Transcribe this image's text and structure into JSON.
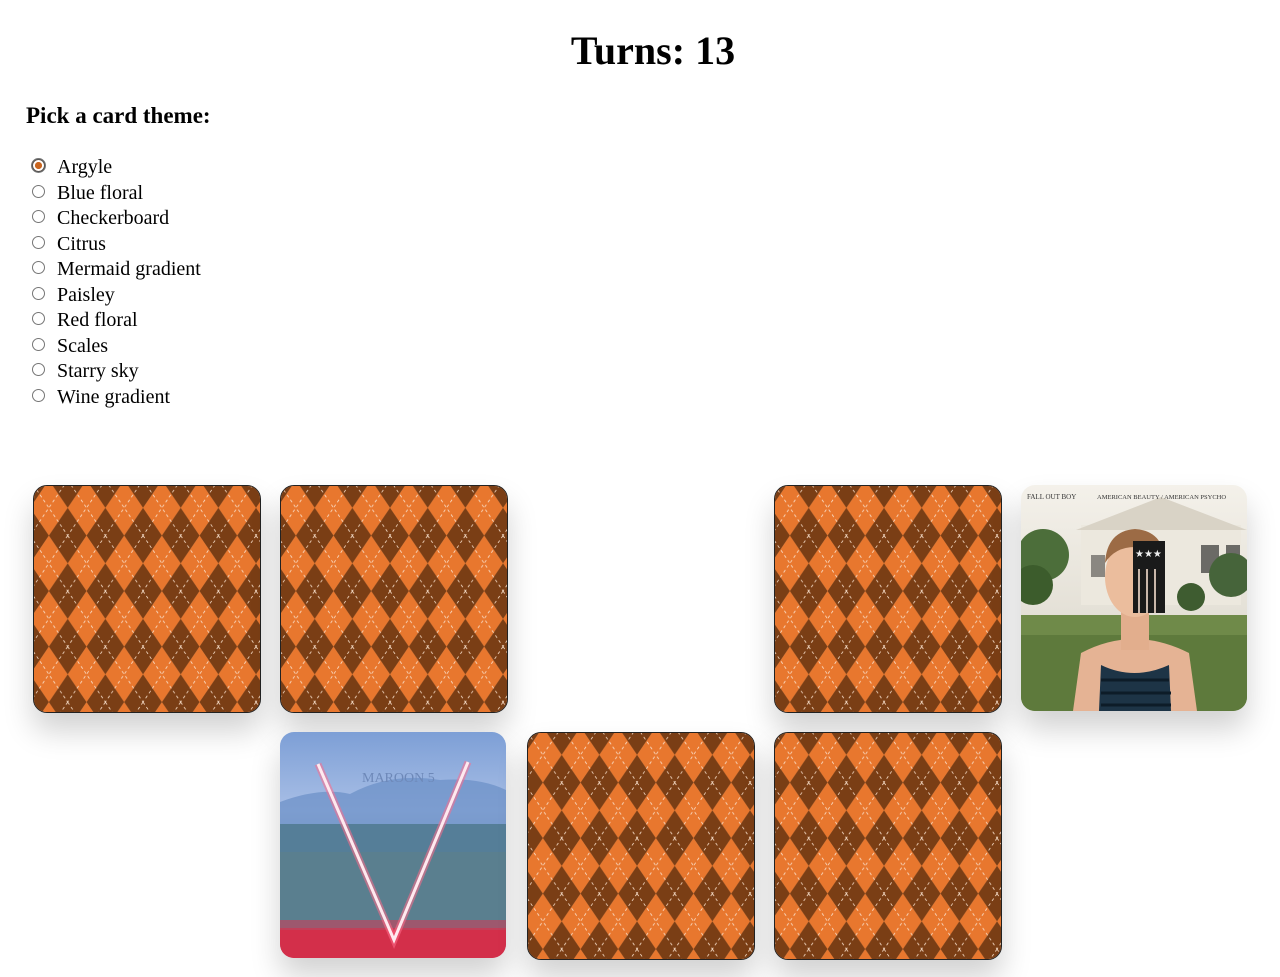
{
  "game": {
    "turns_label": "Turns: 13"
  },
  "theme_picker": {
    "heading": "Pick a card theme:",
    "selected": "Argyle",
    "options": [
      "Argyle",
      "Blue floral",
      "Checkerboard",
      "Citrus",
      "Mermaid gradient",
      "Paisley",
      "Red floral",
      "Scales",
      "Starry sky",
      "Wine gradient"
    ]
  },
  "colors": {
    "argyle_light": "#f2a06a",
    "argyle_mid": "#e8772e",
    "argyle_dark": "#7a3e15"
  },
  "cards": [
    {
      "row": 1,
      "col": 1,
      "state": "face-down",
      "theme": "Argyle"
    },
    {
      "row": 1,
      "col": 2,
      "state": "face-down",
      "theme": "Argyle"
    },
    {
      "row": 1,
      "col": 3,
      "state": "removed"
    },
    {
      "row": 1,
      "col": 4,
      "state": "face-down",
      "theme": "Argyle"
    },
    {
      "row": 1,
      "col": 5,
      "state": "face-up",
      "face": "fall-out-boy-cover",
      "cover_text_left": "FALL OUT BOY",
      "cover_text_right": "AMERICAN BEAUTY / AMERICAN PSYCHO"
    },
    {
      "row": 2,
      "col": 1,
      "state": "removed"
    },
    {
      "row": 2,
      "col": 2,
      "state": "face-up",
      "face": "maroon5-v-cover",
      "cover_text": "MAROON 5"
    },
    {
      "row": 2,
      "col": 3,
      "state": "face-down",
      "theme": "Argyle"
    },
    {
      "row": 2,
      "col": 4,
      "state": "face-down",
      "theme": "Argyle"
    }
  ]
}
